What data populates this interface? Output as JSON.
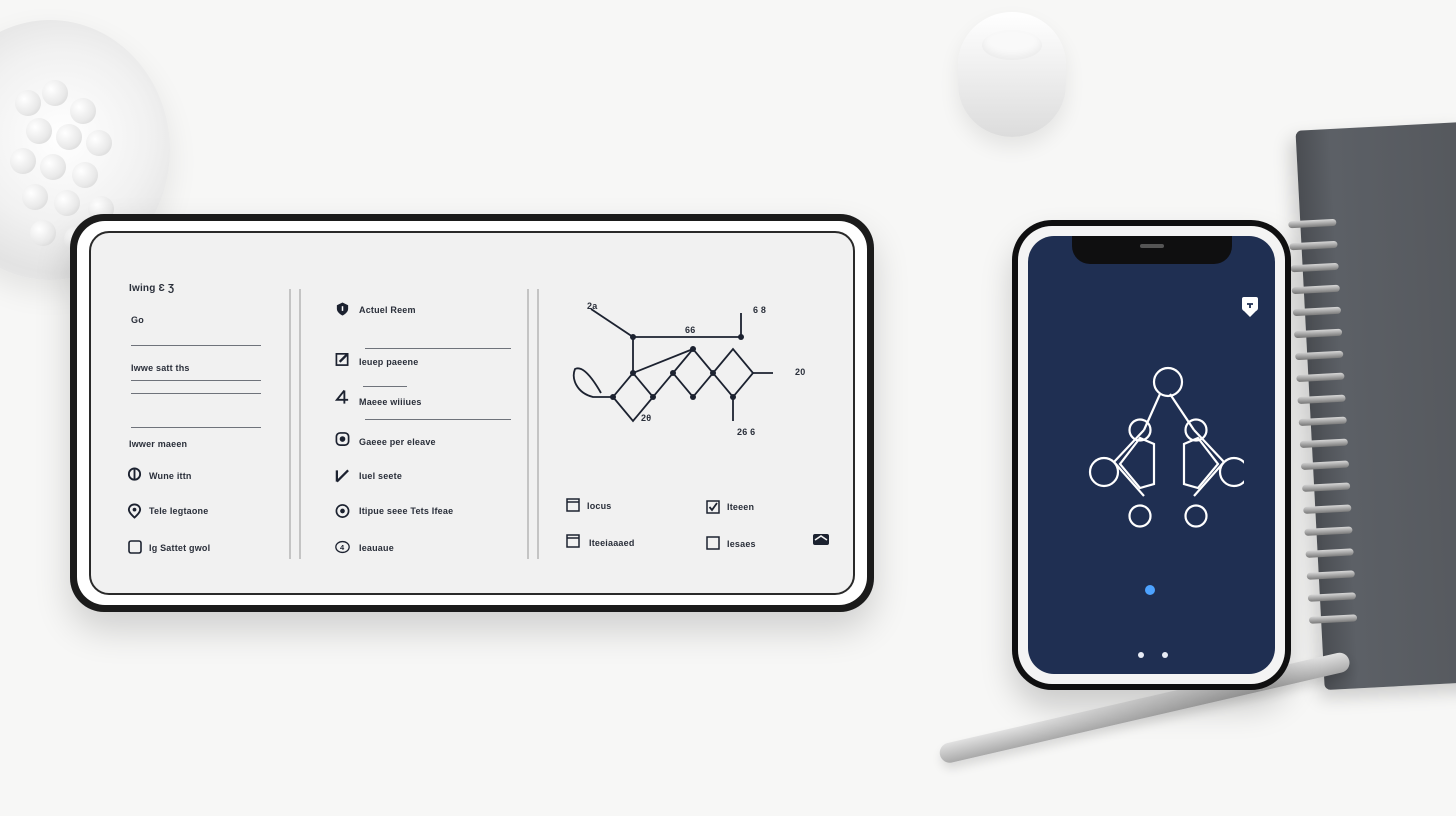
{
  "tablet": {
    "header_title": "Iwing  Ɛ Ʒ",
    "col1": {
      "field_label": "Go",
      "field2_label": "Iwwe satt ths",
      "section_label": "Iwwer maeen",
      "options": [
        {
          "label": "Wune ittn",
          "icon": "speech-bubble-icon"
        },
        {
          "label": "Tele Iegtaone",
          "icon": "location-pin-icon"
        },
        {
          "label": "Ig Sattet gwol",
          "icon": "checkbox-icon"
        }
      ]
    },
    "col2": {
      "items": [
        {
          "label": "Actuel Reem",
          "icon": "shield-icon"
        },
        {
          "label": "Ieuep paeene",
          "icon": "pencil-square-icon"
        },
        {
          "label": "Maeee wiiiues",
          "icon": "number-four-icon"
        },
        {
          "label": "Gaeee per eleave",
          "icon": "dial-icon"
        },
        {
          "label": "Iuel seete",
          "icon": "pencil-icon"
        },
        {
          "label": "Itipue seee  Tets Ifeae",
          "icon": "circle-info-icon"
        },
        {
          "label": "Ieauaue",
          "icon": "number-four-circle-icon"
        }
      ]
    },
    "molecule_labels": {
      "top_left": "2a",
      "top_center": "66",
      "top_right": "6 8",
      "right": "20",
      "bottom_left": "2θ",
      "bottom_right": "26  6"
    },
    "checkbox_grid": [
      {
        "label": "Iocus",
        "checked": false
      },
      {
        "label": "Iteeen",
        "checked": true
      },
      {
        "label": "Iteeiaaaed",
        "checked": false
      },
      {
        "label": "Iesaes",
        "checked": false
      }
    ],
    "corner_icon": "inbox-icon"
  },
  "phone": {
    "screen_color": "#1f2f52",
    "badge_icon": "location-badge-icon",
    "graphic_icon": "network-graph-icon",
    "status_dot_color": "#4da3ff",
    "page_indicator_count": 2
  }
}
